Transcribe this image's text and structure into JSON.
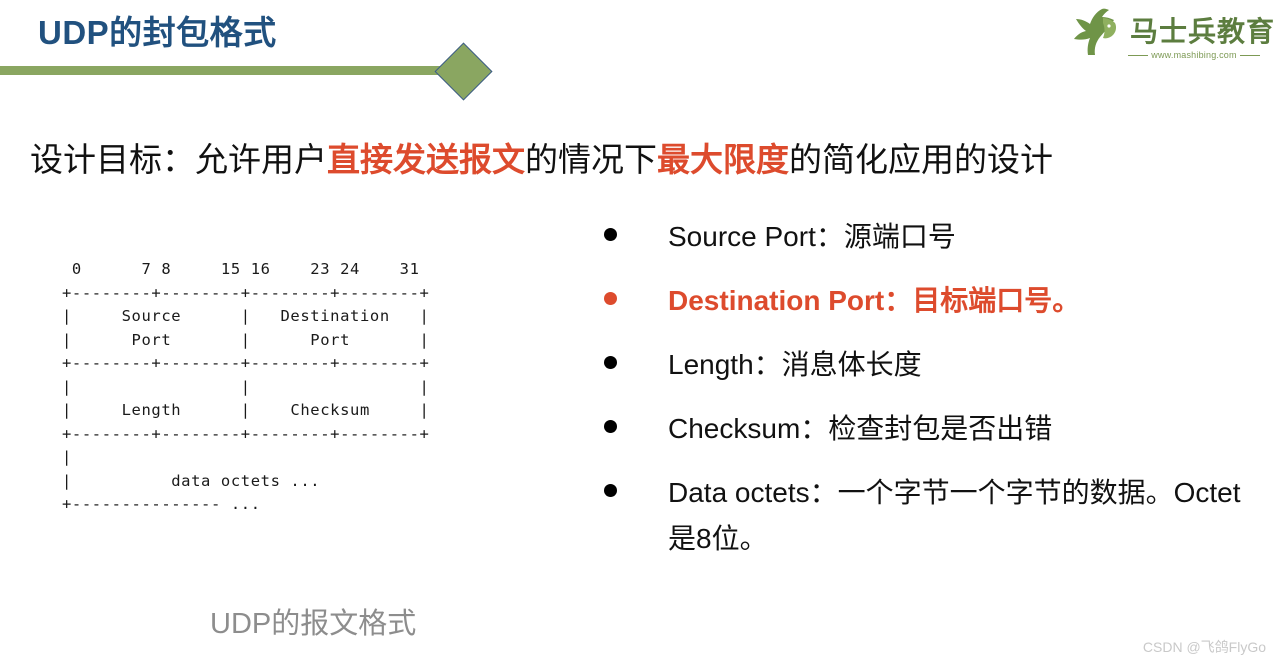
{
  "slide": {
    "title": "UDP的封包格式",
    "title_color": "#21517f",
    "accent_color": "#8aa661",
    "highlight_color": "#dd4b2d"
  },
  "logo": {
    "name": "马士兵教育",
    "url": "www.mashibing.com",
    "icon": "horse-head-icon",
    "color": "#5c7d3f"
  },
  "lead": {
    "part1": "设计目标：允许用户",
    "highlight1": "直接发送报文",
    "part2": "的情况下",
    "highlight2": "最大限度",
    "part3": "的简化应用的设计"
  },
  "diagram": {
    "caption": "UDP的报文格式",
    "bit_ruler": " 0      7 8     15 16    23 24    31",
    "ascii": " 0      7 8     15 16    23 24    31\n+--------+--------+--------+--------+\n|     Source      |   Destination   |\n|      Port       |      Port       |\n+--------+--------+--------+--------+\n|                 |                 |\n|     Length      |    Checksum     |\n+--------+--------+--------+--------+\n|                                     \n|          data octets ...            \n+--------------- ...                  ",
    "fields": [
      {
        "name": "Source Port",
        "bits": "0-15"
      },
      {
        "name": "Destination Port",
        "bits": "16-31"
      },
      {
        "name": "Length",
        "bits": "0-15"
      },
      {
        "name": "Checksum",
        "bits": "16-31"
      },
      {
        "name": "data octets ...",
        "bits": "variable"
      }
    ]
  },
  "bullets": [
    {
      "text": "Source Port：源端口号",
      "accent": false,
      "name": "bullet-source-port"
    },
    {
      "text": "Destination Port：目标端口号。",
      "accent": true,
      "name": "bullet-destination-port"
    },
    {
      "text": "Length：消息体长度",
      "accent": false,
      "name": "bullet-length"
    },
    {
      "text": "Checksum：检查封包是否出错",
      "accent": false,
      "name": "bullet-checksum"
    },
    {
      "text": "Data octets：一个字节一个字节的数据。Octet是8位。",
      "accent": false,
      "name": "bullet-data-octets"
    }
  ],
  "watermark": "CSDN @飞鸽FlyGo"
}
